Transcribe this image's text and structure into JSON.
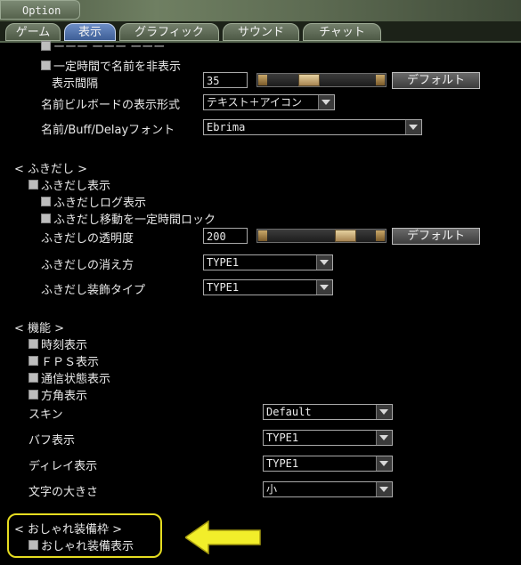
{
  "window": {
    "title": "Option"
  },
  "tabs": [
    {
      "label": "ゲーム"
    },
    {
      "label": "表示",
      "active": true
    },
    {
      "label": "グラフィック"
    },
    {
      "label": "サウンド"
    },
    {
      "label": "チャット"
    }
  ],
  "name_section": {
    "partial_top": "ーーー ーーー ーーー",
    "hide_name_timed": "一定時間で名前を非表示",
    "display_interval_label": "表示間隔",
    "display_interval_value": "35",
    "default_button": "デフォルト",
    "billboard_label": "名前ビルボードの表示形式",
    "billboard_value": "テキスト＋アイコン",
    "font_label": "名前/Buff/Delayフォント",
    "font_value": "Ebrima"
  },
  "fukidashi": {
    "header": "< ふきだし >",
    "show": "ふきだし表示",
    "log": "ふきだしログ表示",
    "lock": "ふきだし移動を一定時間ロック",
    "opacity_label": "ふきだしの透明度",
    "opacity_value": "200",
    "default_button": "デフォルト",
    "fade_label": "ふきだしの消え方",
    "fade_value": "TYPE1",
    "decor_label": "ふきだし装飾タイプ",
    "decor_value": "TYPE1"
  },
  "kinou": {
    "header": "< 機能 >",
    "clock": "時刻表示",
    "fps": "ＦＰＳ表示",
    "network": "通信状態表示",
    "compass": "方角表示",
    "skin_label": "スキン",
    "skin_value": "Default",
    "buff_label": "バフ表示",
    "buff_value": "TYPE1",
    "delay_label": "ディレイ表示",
    "delay_value": "TYPE1",
    "textsize_label": "文字の大きさ",
    "textsize_value": "小"
  },
  "oshare": {
    "header": "< おしゃれ装備枠 >",
    "show": "おしゃれ装備表示"
  },
  "annotation": {
    "highlight_color": "#e6dd21",
    "arrow_color": "#f2ee2a"
  },
  "slider_levels": {
    "display_interval": 0.35,
    "fukidashi_opacity": 0.78
  }
}
